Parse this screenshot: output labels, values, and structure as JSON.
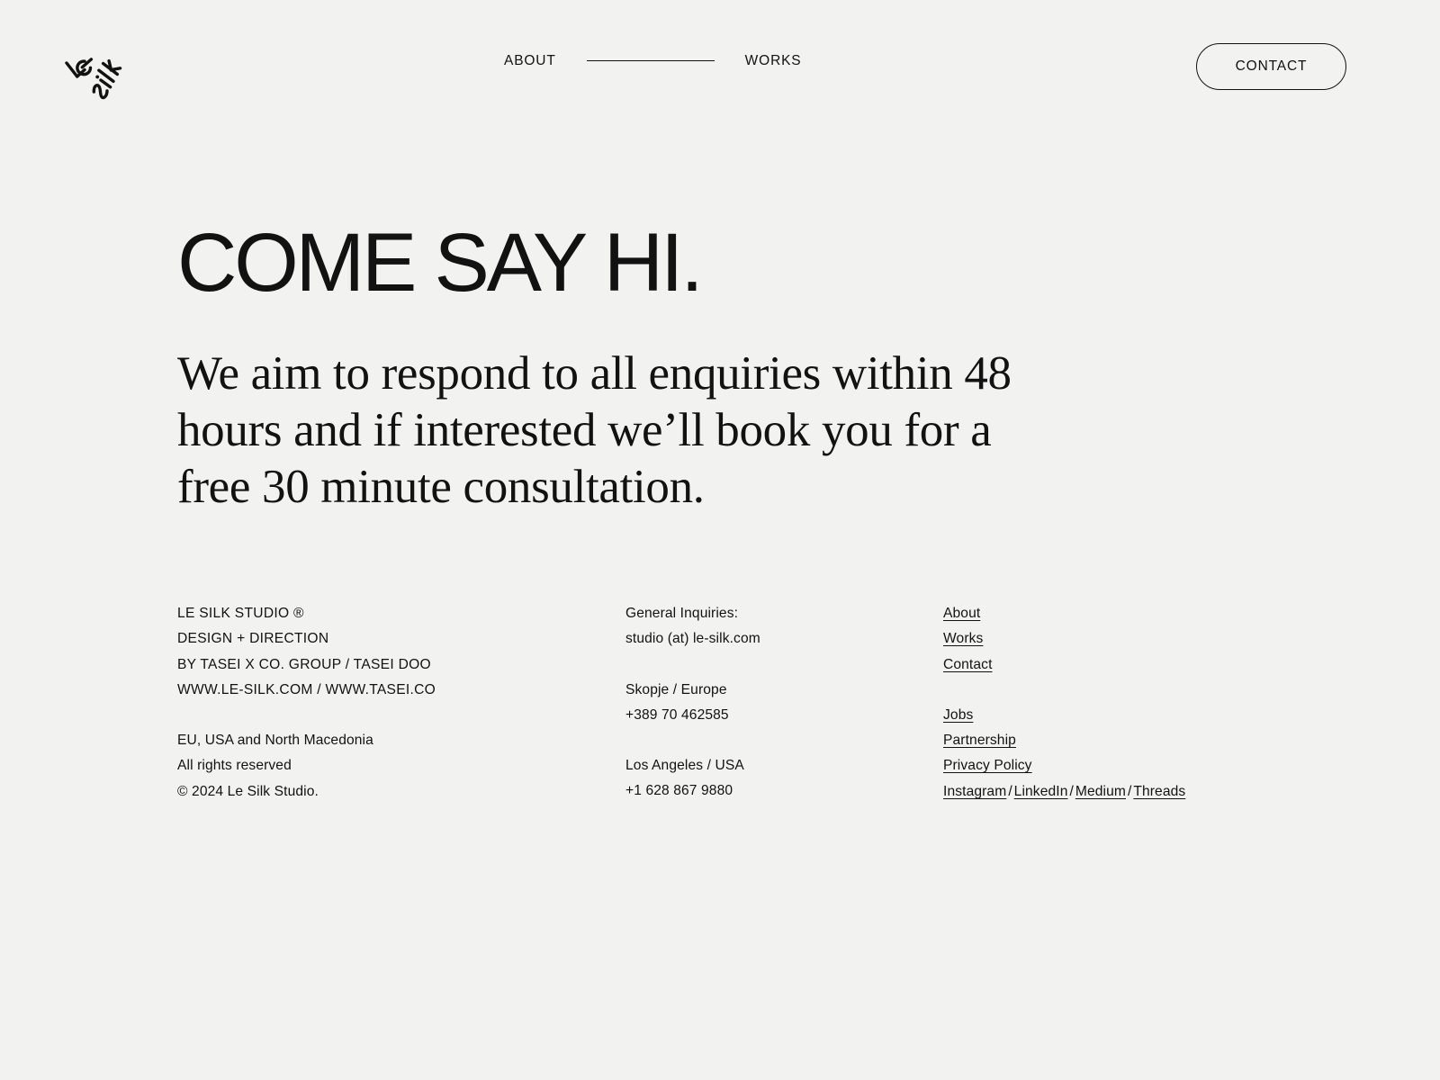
{
  "theme": {
    "background": "#f2f2f1",
    "text": "#121212",
    "rule": "#121212"
  },
  "header": {
    "logo_alt": "Le Silk",
    "logo_letters_top": "Le",
    "logo_letters_bottom": "Silk",
    "nav": [
      {
        "label": "ABOUT",
        "name": "nav-link-about"
      },
      {
        "label": "WORKS",
        "name": "nav-link-works"
      }
    ],
    "contact_button": "CONTACT"
  },
  "hero": {
    "title": "COME SAY HI.",
    "subtitle": "We aim to respond to all enquiries within 48 hours and if interested we’ll book you for a free 30 minute consultation."
  },
  "footer": {
    "studio": {
      "lines_top": [
        "LE SILK STUDIO ®",
        "DESIGN + DIRECTION",
        "BY TASEI X CO. GROUP / TASEI DOO",
        "WWW.LE-SILK.COM / WWW.TASEI.CO"
      ],
      "lines_bottom": [
        "EU, USA and North Macedonia",
        "All rights reserved",
        "© 2024 Le Silk Studio."
      ]
    },
    "contact": {
      "group_general": [
        "General Inquiries:",
        "studio (at) le-silk.com"
      ],
      "group_skopje": [
        "Skopje / Europe",
        "+389 70 462585"
      ],
      "group_la": [
        "Los Angeles / USA",
        "+1 628 867 9880"
      ]
    },
    "links": {
      "primary": [
        "About",
        "Works",
        "Contact"
      ],
      "secondary": [
        "Jobs",
        "Partnership",
        "Privacy Policy"
      ],
      "social": [
        "Instagram",
        "LinkedIn",
        "Medium",
        "Threads"
      ],
      "social_separator": "/"
    }
  }
}
